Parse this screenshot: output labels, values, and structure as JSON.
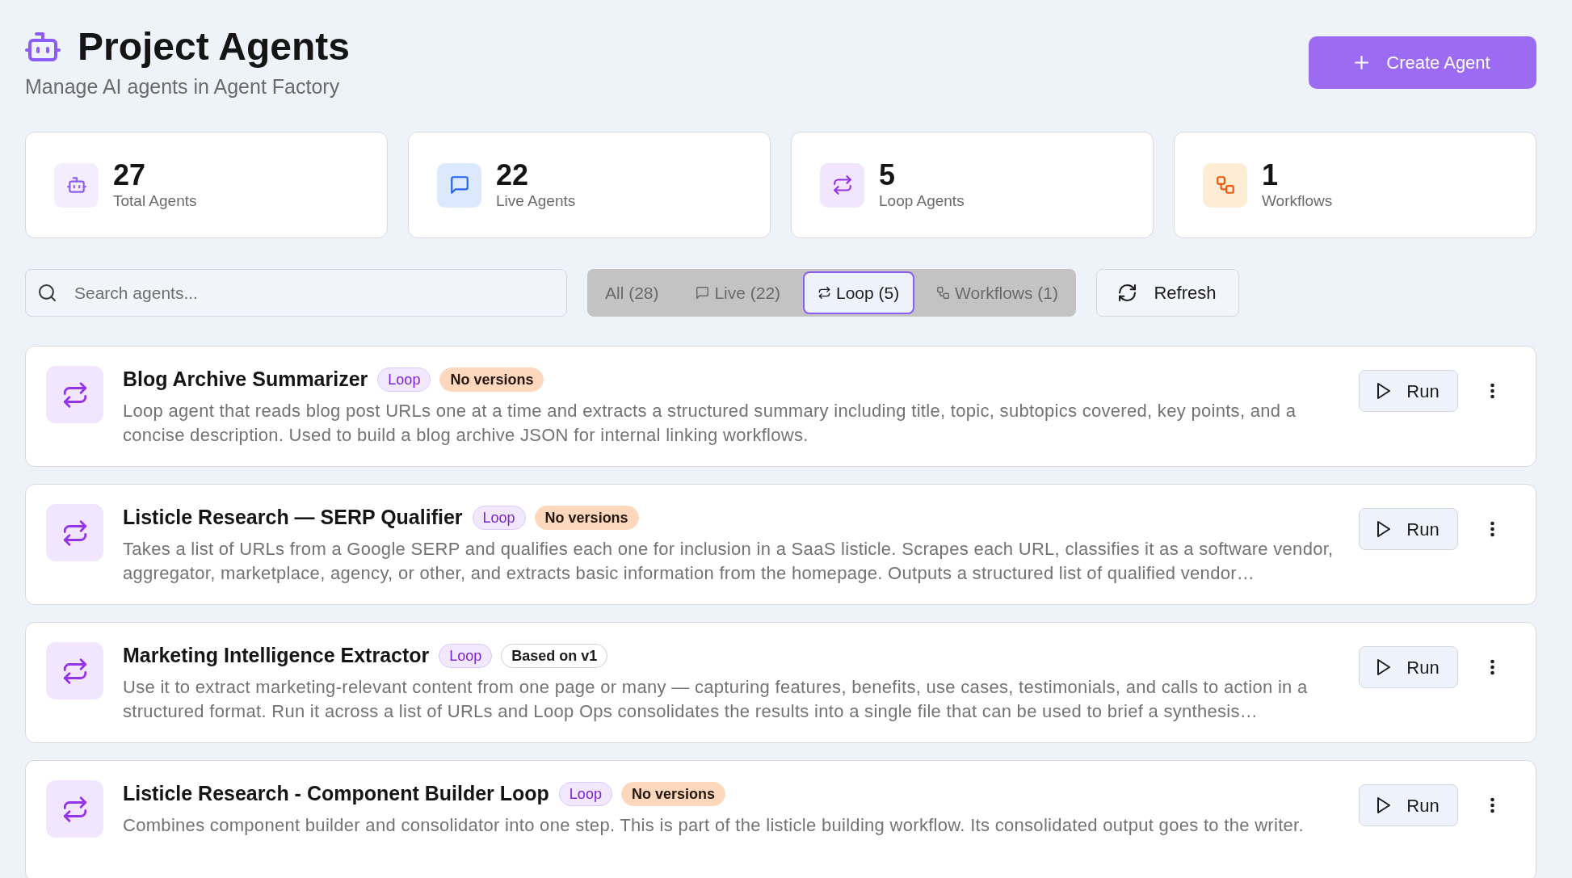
{
  "header": {
    "title": "Project Agents",
    "subtitle": "Manage AI agents in Agent Factory",
    "create_button": "Create Agent"
  },
  "stats": [
    {
      "kind": "agents",
      "value": "27",
      "label": "Total Agents"
    },
    {
      "kind": "live",
      "value": "22",
      "label": "Live Agents"
    },
    {
      "kind": "loop",
      "value": "5",
      "label": "Loop Agents"
    },
    {
      "kind": "workflow",
      "value": "1",
      "label": "Workflows"
    }
  ],
  "search": {
    "placeholder": "Search agents..."
  },
  "filters": [
    {
      "kind": "all",
      "label": "All (28)",
      "selected": false
    },
    {
      "kind": "live",
      "label": "Live (22)",
      "selected": false
    },
    {
      "kind": "loop",
      "label": "Loop (5)",
      "selected": true
    },
    {
      "kind": "workflow",
      "label": "Workflows (1)",
      "selected": false
    }
  ],
  "refresh_button": "Refresh",
  "agents": [
    {
      "kind": "loop",
      "name": "Blog Archive Summarizer",
      "badges": [
        {
          "kind": "type",
          "label": "Loop"
        },
        {
          "kind": "warning",
          "label": "No versions"
        }
      ],
      "description": "Loop agent that reads blog post URLs one at a time and extracts a structured summary including title, topic, subtopics covered, key points, and a concise description. Used to build a blog archive JSON for internal linking workflows.",
      "run_button": "Run"
    },
    {
      "kind": "loop",
      "name": "Listicle Research — SERP Qualifier",
      "badges": [
        {
          "kind": "type",
          "label": "Loop"
        },
        {
          "kind": "warning",
          "label": "No versions"
        }
      ],
      "description": "Takes a list of URLs from a Google SERP and qualifies each one for inclusion in a SaaS listicle. Scrapes each URL, classifies it as a software vendor, aggregator, marketplace, agency, or other, and extracts basic information from the homepage. Outputs a structured list of qualified vendor…",
      "run_button": "Run"
    },
    {
      "kind": "loop",
      "name": "Marketing Intelligence Extractor",
      "badges": [
        {
          "kind": "type",
          "label": "Loop"
        },
        {
          "kind": "neutral",
          "label": "Based on v1"
        }
      ],
      "description": "Use it to extract marketing-relevant content from one page or many — capturing features, benefits, use cases, testimonials, and calls to action in a structured format. Run it across a list of URLs and Loop Ops consolidates the results into a single file that can be used to brief a synthesis…",
      "run_button": "Run"
    },
    {
      "kind": "loop",
      "name": "Listicle Research - Component Builder Loop",
      "badges": [
        {
          "kind": "type",
          "label": "Loop"
        },
        {
          "kind": "warning",
          "label": "No versions"
        }
      ],
      "description": "Combines component builder and consolidator into one step. This is part of the listicle building workflow. Its consolidated output goes to the writer.",
      "run_button": "Run"
    }
  ]
}
